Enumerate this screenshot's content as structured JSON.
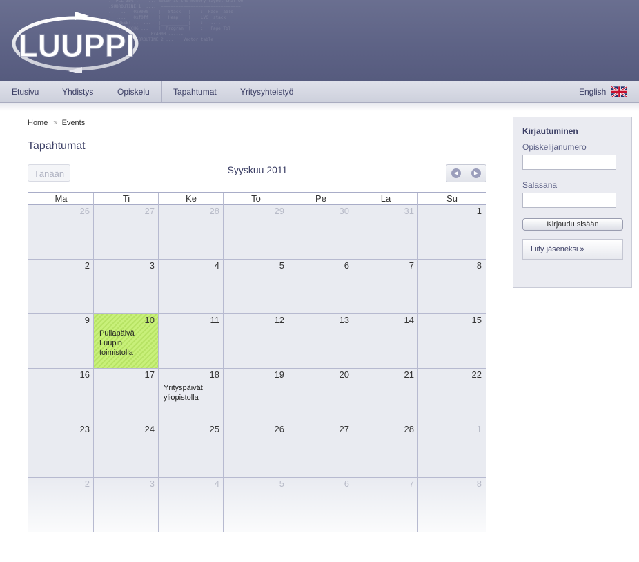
{
  "header": {
    "logo_text": "LUUPPI"
  },
  "nav": {
    "items": [
      "Etusivu",
      "Yhdistys",
      "Opiskelu",
      "Tapahtumat",
      "Yritysyhteistyö"
    ],
    "language": "English"
  },
  "breadcrumb": {
    "home": "Home",
    "separator": "»",
    "current": "Events"
  },
  "page_title": "Tapahtumat",
  "calendar": {
    "today_label": "Tänään",
    "month_title": "Syyskuu 2011",
    "weekdays": [
      "Ma",
      "Ti",
      "Ke",
      "To",
      "Pe",
      "La",
      "Su"
    ],
    "weeks": [
      [
        "26",
        "27",
        "28",
        "29",
        "30",
        "31",
        "1"
      ],
      [
        "2",
        "3",
        "4",
        "5",
        "6",
        "7",
        "8"
      ],
      [
        "9",
        "10",
        "11",
        "12",
        "13",
        "14",
        "15"
      ],
      [
        "16",
        "17",
        "18",
        "19",
        "20",
        "21",
        "22"
      ],
      [
        "23",
        "24",
        "25",
        "26",
        "27",
        "28",
        "1"
      ],
      [
        "2",
        "3",
        "4",
        "5",
        "6",
        "7",
        "8"
      ]
    ],
    "events": [
      {
        "text": "Pullapäivä Luupin toimistolla",
        "date": "10"
      },
      {
        "text": "Yrityspäivät yliopistolla",
        "date": "18"
      }
    ]
  },
  "login": {
    "title": "Kirjautuminen",
    "student_number_label": "Opiskelijanumero",
    "password_label": "Salasana",
    "submit_label": "Kirjaudu sisään",
    "join_link": "Liity jäseneksi »"
  },
  "colors": {
    "header_bg": "#5d6285",
    "accent": "#3d4066",
    "today_green": "#c8f07a"
  }
}
